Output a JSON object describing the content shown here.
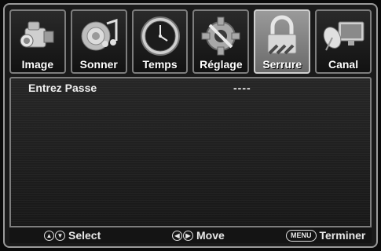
{
  "tabs": [
    {
      "label": "Image",
      "icon": "camcorder-icon",
      "active": false
    },
    {
      "label": "Sonner",
      "icon": "speaker-music-icon",
      "active": false
    },
    {
      "label": "Temps",
      "icon": "clock-icon",
      "active": false
    },
    {
      "label": "Réglage",
      "icon": "gear-tools-icon",
      "active": false
    },
    {
      "label": "Serrure",
      "icon": "padlock-icon",
      "active": true
    },
    {
      "label": "Canal",
      "icon": "satellite-tv-icon",
      "active": false
    }
  ],
  "content": {
    "prompt": "Entrez Passe",
    "password_value": "----"
  },
  "footer": {
    "select": "Select",
    "move": "Move",
    "menu_key": "MENU",
    "finish": "Terminer"
  }
}
